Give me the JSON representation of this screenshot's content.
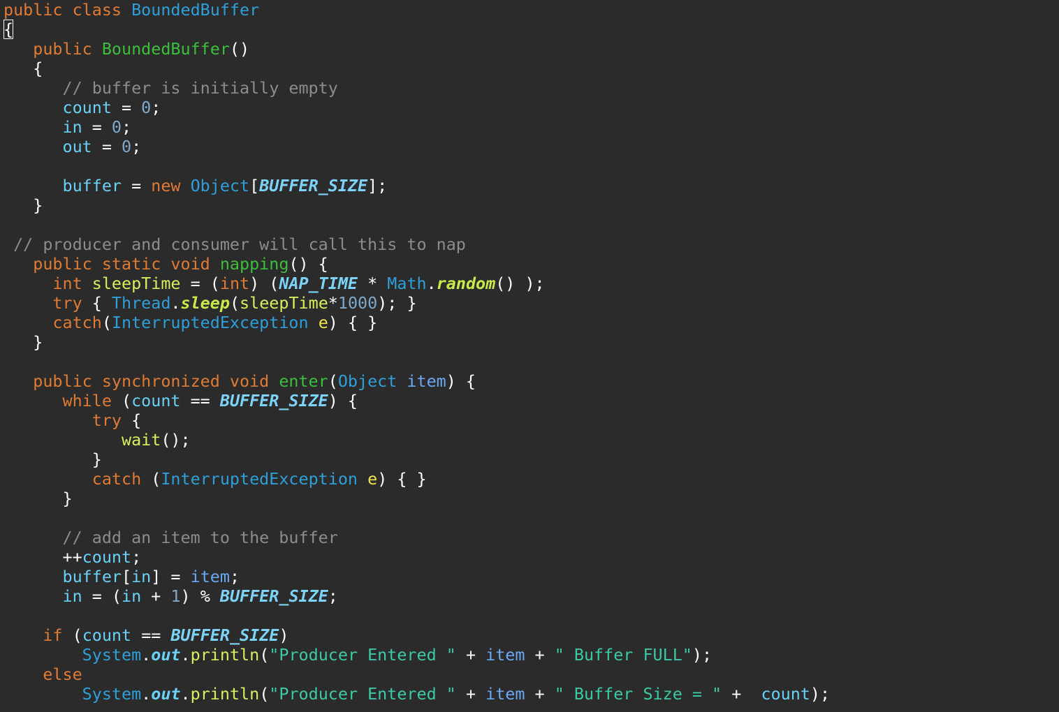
{
  "editor": {
    "colors": {
      "background": "#2b2b2b",
      "keyword": "#e07b33",
      "class": "#2e9fd9",
      "method_def": "#3cbf3c",
      "comment": "#8c8c8c",
      "variable": "#6ad0f5",
      "number": "#7fa8c9",
      "constant": "#7dd3f7",
      "string": "#3cc9a6",
      "parameter": "#f0e64a"
    },
    "lines": [
      [
        [
          "kw",
          "public class "
        ],
        [
          "cls",
          "BoundedBuffer"
        ]
      ],
      [
        [
          "cursor",
          "{"
        ]
      ],
      [
        [
          "plain",
          "   "
        ],
        [
          "kw",
          "public "
        ],
        [
          "mdef",
          "BoundedBuffer"
        ],
        [
          "plain",
          "()"
        ]
      ],
      [
        [
          "plain",
          "   {"
        ]
      ],
      [
        [
          "plain",
          "      "
        ],
        [
          "cmt",
          "// buffer is initially empty"
        ]
      ],
      [
        [
          "plain",
          "      "
        ],
        [
          "var",
          "count"
        ],
        [
          "plain",
          " = "
        ],
        [
          "num",
          "0"
        ],
        [
          "plain",
          ";"
        ]
      ],
      [
        [
          "plain",
          "      "
        ],
        [
          "var",
          "in"
        ],
        [
          "plain",
          " = "
        ],
        [
          "num",
          "0"
        ],
        [
          "plain",
          ";"
        ]
      ],
      [
        [
          "plain",
          "      "
        ],
        [
          "var",
          "out"
        ],
        [
          "plain",
          " = "
        ],
        [
          "num",
          "0"
        ],
        [
          "plain",
          ";"
        ]
      ],
      [],
      [
        [
          "plain",
          "      "
        ],
        [
          "var",
          "buffer"
        ],
        [
          "plain",
          " = "
        ],
        [
          "kw",
          "new "
        ],
        [
          "cls",
          "Object"
        ],
        [
          "plain",
          "["
        ],
        [
          "const",
          "BUFFER_SIZE"
        ],
        [
          "plain",
          "];"
        ]
      ],
      [
        [
          "plain",
          "   }"
        ]
      ],
      [],
      [
        [
          "plain",
          " "
        ],
        [
          "cmt",
          "// producer and consumer will call this to nap"
        ]
      ],
      [
        [
          "plain",
          "   "
        ],
        [
          "kw",
          "public static void "
        ],
        [
          "mdef",
          "napping"
        ],
        [
          "plain",
          "() {"
        ]
      ],
      [
        [
          "plain",
          "     "
        ],
        [
          "kw",
          "int "
        ],
        [
          "call",
          "sleepTime"
        ],
        [
          "plain",
          " = ("
        ],
        [
          "kw",
          "int"
        ],
        [
          "plain",
          ") ("
        ],
        [
          "const",
          "NAP_TIME"
        ],
        [
          "plain",
          " * "
        ],
        [
          "cls",
          "Math"
        ],
        [
          "plain",
          "."
        ],
        [
          "static",
          "random"
        ],
        [
          "plain",
          "() );"
        ]
      ],
      [
        [
          "plain",
          "     "
        ],
        [
          "kw",
          "try"
        ],
        [
          "plain",
          " { "
        ],
        [
          "cls",
          "Thread"
        ],
        [
          "plain",
          "."
        ],
        [
          "static",
          "sleep"
        ],
        [
          "plain",
          "("
        ],
        [
          "call",
          "sleepTime"
        ],
        [
          "plain",
          "*"
        ],
        [
          "num",
          "1000"
        ],
        [
          "plain",
          "); }"
        ]
      ],
      [
        [
          "plain",
          "     "
        ],
        [
          "kw",
          "catch"
        ],
        [
          "plain",
          "("
        ],
        [
          "cls",
          "InterruptedException"
        ],
        [
          "plain",
          " "
        ],
        [
          "param",
          "e"
        ],
        [
          "plain",
          ") { }"
        ]
      ],
      [
        [
          "plain",
          "   }"
        ]
      ],
      [],
      [
        [
          "plain",
          "   "
        ],
        [
          "kw",
          "public synchronized void "
        ],
        [
          "mdef",
          "enter"
        ],
        [
          "plain",
          "("
        ],
        [
          "cls",
          "Object"
        ],
        [
          "plain",
          " "
        ],
        [
          "item",
          "item"
        ],
        [
          "plain",
          ") {"
        ]
      ],
      [
        [
          "plain",
          "      "
        ],
        [
          "kw",
          "while"
        ],
        [
          "plain",
          " ("
        ],
        [
          "var",
          "count"
        ],
        [
          "plain",
          " == "
        ],
        [
          "const",
          "BUFFER_SIZE"
        ],
        [
          "plain",
          ") {"
        ]
      ],
      [
        [
          "plain",
          "         "
        ],
        [
          "kw",
          "try"
        ],
        [
          "plain",
          " {"
        ]
      ],
      [
        [
          "plain",
          "            "
        ],
        [
          "call",
          "wait"
        ],
        [
          "plain",
          "();"
        ]
      ],
      [
        [
          "plain",
          "         }"
        ]
      ],
      [
        [
          "plain",
          "         "
        ],
        [
          "kw",
          "catch"
        ],
        [
          "plain",
          " ("
        ],
        [
          "cls",
          "InterruptedException"
        ],
        [
          "plain",
          " "
        ],
        [
          "param",
          "e"
        ],
        [
          "plain",
          ") { }"
        ]
      ],
      [
        [
          "plain",
          "      }"
        ]
      ],
      [],
      [
        [
          "plain",
          "      "
        ],
        [
          "cmt",
          "// add an item to the buffer"
        ]
      ],
      [
        [
          "plain",
          "      ++"
        ],
        [
          "var",
          "count"
        ],
        [
          "plain",
          ";"
        ]
      ],
      [
        [
          "plain",
          "      "
        ],
        [
          "var",
          "buffer"
        ],
        [
          "plain",
          "["
        ],
        [
          "var",
          "in"
        ],
        [
          "plain",
          "] = "
        ],
        [
          "item",
          "item"
        ],
        [
          "plain",
          ";"
        ]
      ],
      [
        [
          "plain",
          "      "
        ],
        [
          "var",
          "in"
        ],
        [
          "plain",
          " = ("
        ],
        [
          "var",
          "in"
        ],
        [
          "plain",
          " + "
        ],
        [
          "num",
          "1"
        ],
        [
          "plain",
          ") % "
        ],
        [
          "const",
          "BUFFER_SIZE"
        ],
        [
          "plain",
          ";"
        ]
      ],
      [],
      [
        [
          "plain",
          "    "
        ],
        [
          "kw",
          "if"
        ],
        [
          "plain",
          " ("
        ],
        [
          "var",
          "count"
        ],
        [
          "plain",
          " == "
        ],
        [
          "const",
          "BUFFER_SIZE"
        ],
        [
          "plain",
          ")"
        ]
      ],
      [
        [
          "plain",
          "        "
        ],
        [
          "cls",
          "System"
        ],
        [
          "plain",
          "."
        ],
        [
          "field",
          "out"
        ],
        [
          "plain",
          "."
        ],
        [
          "call",
          "println"
        ],
        [
          "plain",
          "("
        ],
        [
          "str",
          "\"Producer Entered \""
        ],
        [
          "plain",
          " + "
        ],
        [
          "item",
          "item"
        ],
        [
          "plain",
          " + "
        ],
        [
          "str",
          "\" Buffer FULL\""
        ],
        [
          "plain",
          ");"
        ]
      ],
      [
        [
          "plain",
          "    "
        ],
        [
          "kw",
          "else"
        ]
      ],
      [
        [
          "plain",
          "        "
        ],
        [
          "cls",
          "System"
        ],
        [
          "plain",
          "."
        ],
        [
          "field",
          "out"
        ],
        [
          "plain",
          "."
        ],
        [
          "call",
          "println"
        ],
        [
          "plain",
          "("
        ],
        [
          "str",
          "\"Producer Entered \""
        ],
        [
          "plain",
          " + "
        ],
        [
          "item",
          "item"
        ],
        [
          "plain",
          " + "
        ],
        [
          "str",
          "\" Buffer Size = \""
        ],
        [
          "plain",
          " +  "
        ],
        [
          "var",
          "count"
        ],
        [
          "plain",
          ");"
        ]
      ]
    ]
  }
}
